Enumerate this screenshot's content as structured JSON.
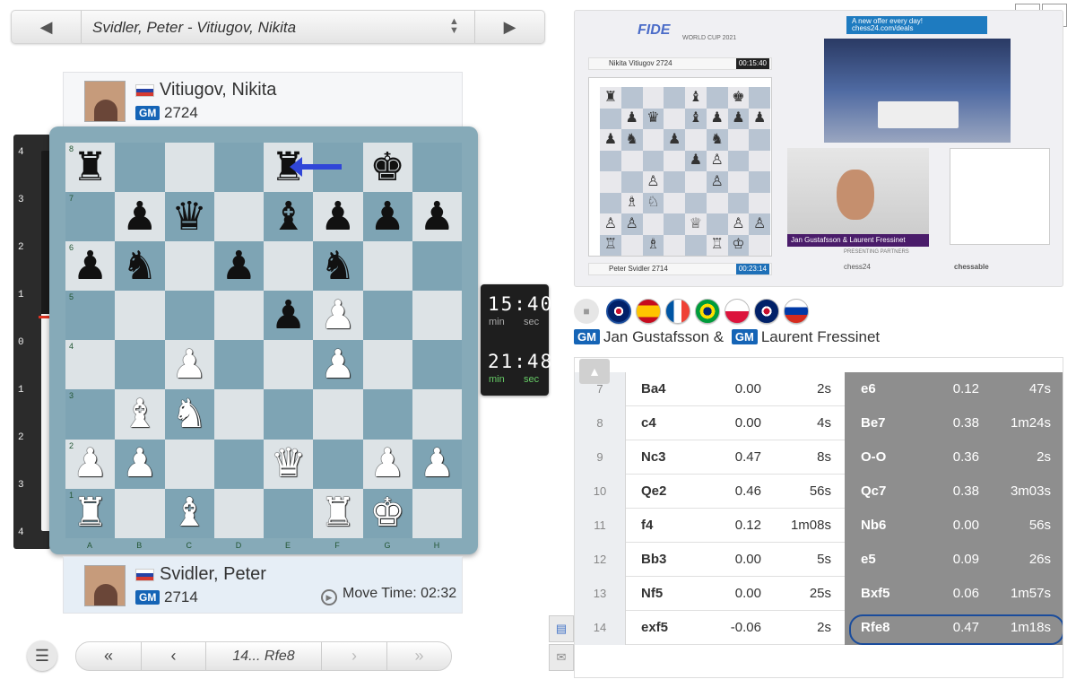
{
  "header": {
    "game_title": "Svidler, Peter - Vitiugov, Nikita",
    "prev_icon": "prev-game-icon",
    "next_icon": "next-game-icon"
  },
  "top_player": {
    "name": "Vitiugov, Nikita",
    "title": "GM",
    "rating": "2724",
    "flag": "russia"
  },
  "bottom_player": {
    "name": "Svidler, Peter",
    "title": "GM",
    "rating": "2714",
    "flag": "russia",
    "move_time_label": "Move Time: 02:32"
  },
  "eval_bar": {
    "labels_top": [
      "4",
      "3",
      "2",
      "1",
      "0",
      "1",
      "2",
      "3",
      "4"
    ],
    "white_fraction": 0.57
  },
  "clock": {
    "black": {
      "time": "15:40",
      "min": "min",
      "sec": "sec"
    },
    "white": {
      "time": "21:48",
      "min": "min",
      "sec": "sec"
    }
  },
  "board": {
    "files": [
      "A",
      "B",
      "C",
      "D",
      "E",
      "F",
      "G",
      "H"
    ],
    "ranks": [
      "8",
      "7",
      "6",
      "5",
      "4",
      "3",
      "2",
      "1"
    ],
    "position": [
      [
        "br",
        "",
        "",
        "",
        "br",
        "",
        "bk",
        ""
      ],
      [
        "",
        "bp",
        "bq",
        "",
        "bb",
        "bp",
        "bp",
        "bp"
      ],
      [
        "bp",
        "bn",
        "",
        "bp",
        "",
        "bn",
        "",
        ""
      ],
      [
        "",
        "",
        "",
        "",
        "bp",
        "wp",
        "",
        ""
      ],
      [
        "",
        "",
        "wp",
        "",
        "",
        "wp",
        "",
        ""
      ],
      [
        "",
        "wb",
        "wn",
        "",
        "",
        "",
        "",
        ""
      ],
      [
        "wp",
        "wp",
        "",
        "",
        "wq",
        "",
        "wp",
        "wp"
      ],
      [
        "wr",
        "",
        "wb",
        "",
        "",
        "wr",
        "wk",
        ""
      ]
    ]
  },
  "navigation": {
    "first": "«",
    "prev": "‹",
    "current_move": "14... Rfe8",
    "next": "›",
    "last": "»",
    "menu_icon": "menu-icon"
  },
  "video": {
    "event_logo": "FIDE",
    "event_sub": "WORLD CUP 2021",
    "ad_text": "A new offer every day! chess24.com/deals",
    "top_name": "Nikita Vitiugov 2724",
    "top_clock": "00:15:40",
    "bottom_name": "Peter Svidler 2714",
    "bottom_clock": "00:23:14",
    "host_caption": "Jan Gustafsson & Laurent Fressinet",
    "presenting": "PRESENTING PARTNERS",
    "sponsors": [
      "chess24",
      "chessable"
    ],
    "board_position": [
      [
        "♜",
        "",
        "",
        "",
        "♝",
        "",
        "♚",
        ""
      ],
      [
        "",
        "♟",
        "♛",
        "",
        "♝",
        "♟",
        "♟",
        "♟"
      ],
      [
        "♟",
        "♞",
        "",
        "♟",
        "",
        "♞",
        "",
        ""
      ],
      [
        "",
        "",
        "",
        "",
        "♟",
        "♙",
        "",
        ""
      ],
      [
        "",
        "",
        "♙",
        "",
        "",
        "♙",
        "",
        ""
      ],
      [
        "",
        "♗",
        "♘",
        "",
        "",
        "",
        "",
        ""
      ],
      [
        "♙",
        "♙",
        "",
        "",
        "♕",
        "",
        "♙",
        "♙"
      ],
      [
        "♖",
        "",
        "♗",
        "",
        "",
        "♖",
        "♔",
        ""
      ]
    ]
  },
  "commentary": {
    "languages": [
      "uk",
      "spain",
      "france",
      "brazil",
      "poland",
      "uk",
      "russia"
    ],
    "selected": 0,
    "host1_title": "GM",
    "host1": "Jan Gustafsson &",
    "host2_title": "GM",
    "host2": "Laurent Fressinet"
  },
  "moves": [
    {
      "num": "7",
      "w": "Ba4",
      "we": "0.00",
      "wt": "2s",
      "b": "e6",
      "be": "0.12",
      "bt": "47s"
    },
    {
      "num": "8",
      "w": "c4",
      "we": "0.00",
      "wt": "4s",
      "b": "Be7",
      "be": "0.38",
      "bt": "1m24s"
    },
    {
      "num": "9",
      "w": "Nc3",
      "we": "0.47",
      "wt": "8s",
      "b": "O-O",
      "be": "0.36",
      "bt": "2s"
    },
    {
      "num": "10",
      "w": "Qe2",
      "we": "0.46",
      "wt": "56s",
      "b": "Qc7",
      "be": "0.38",
      "bt": "3m03s"
    },
    {
      "num": "11",
      "w": "f4",
      "we": "0.12",
      "wt": "1m08s",
      "b": "Nb6",
      "be": "0.00",
      "bt": "56s"
    },
    {
      "num": "12",
      "w": "Bb3",
      "we": "0.00",
      "wt": "5s",
      "b": "e5",
      "be": "0.09",
      "bt": "26s"
    },
    {
      "num": "13",
      "w": "Nf5",
      "we": "0.00",
      "wt": "25s",
      "b": "Bxf5",
      "be": "0.06",
      "bt": "1m57s"
    },
    {
      "num": "14",
      "w": "exf5",
      "we": "-0.06",
      "wt": "2s",
      "b": "Rfe8",
      "be": "0.47",
      "bt": "1m18s"
    }
  ],
  "colors": {
    "board_light": "#dde3e6",
    "board_dark": "#7ea4b4",
    "gm_badge": "#1564b6",
    "black_move_bg": "#8e8e8e",
    "highlight": "#1a4c9c"
  }
}
